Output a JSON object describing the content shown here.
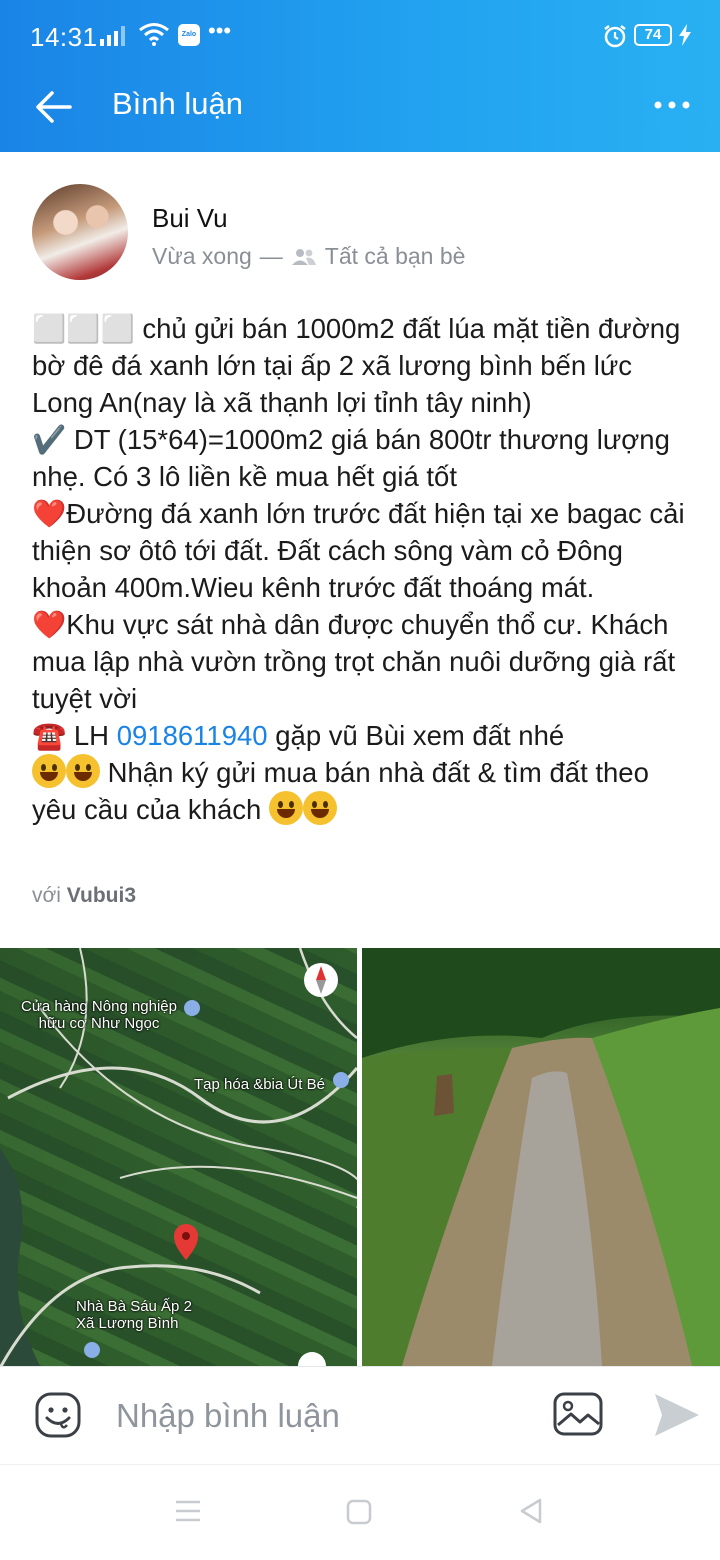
{
  "status_bar": {
    "time": "14:31",
    "zalo_label": "Zalo",
    "battery": "74",
    "icons": [
      "signal-icon",
      "wifi-icon",
      "zalo-icon",
      "more-dots-icon",
      "alarm-icon",
      "battery-icon",
      "charging-icon"
    ]
  },
  "header": {
    "title": "Bình luận",
    "back_icon": "back-arrow-icon",
    "more_icon": "more-horizontal-icon",
    "gradient": [
      "#1a84e6",
      "#29b0f2"
    ]
  },
  "post": {
    "author": "Bui Vu",
    "time": "Vừa xong",
    "separator": "—",
    "audience": "Tất cả bạn bè",
    "paragraphs": {
      "p1": "⬜⬜⬜ chủ gửi bán 1000m2 đất lúa mặt tiền đường bờ đê đá xanh lớn tại ấp 2 xã lương bình bến lức Long An(nay là xã thạnh lợi tỉnh tây ninh)",
      "p2": "✔️ DT (15*64)=1000m2 giá bán 800tr thương lượng nhẹ. Có 3 lô liền kề mua hết giá tốt",
      "p3_heart": "❤️",
      "p3": "Đường đá xanh lớn trước đất hiện tại xe bagac cải thiện sơ ôtô tới đất. Đất cách sông vàm cỏ Đông khoản 400m.Wieu kênh trước đất thoáng mát.",
      "p4_heart": "❤️",
      "p4": "Khu vực sát nhà dân được chuyển thổ cư. Khách mua lập nhà vườn trồng trọt chăn nuôi dưỡng già rất tuyệt vời",
      "p5_prefix": "☎️ LH ",
      "p5_phone": "0918611940",
      "p5_suffix": " gặp vũ Bùi xem đất nhé",
      "p6": " Nhận ký gửi mua bán nhà đất & tìm đất theo yêu cầu của khách "
    },
    "tagged_prefix": "với",
    "tagged_name": "Vubui3"
  },
  "photos": {
    "map": {
      "labels": {
        "shop": "Cửa hàng Nông nghiệp\nhữu cơ Như Ngọc",
        "grocery": "Tạp hóa &bia Út Bé",
        "house": "Nhà Bà Sáu Ấp 2\nXã Lương Bình"
      }
    }
  },
  "comment_bar": {
    "placeholder": "Nhập bình luận"
  },
  "colors": {
    "link": "#1a84e6",
    "meta": "#8a8f96"
  }
}
